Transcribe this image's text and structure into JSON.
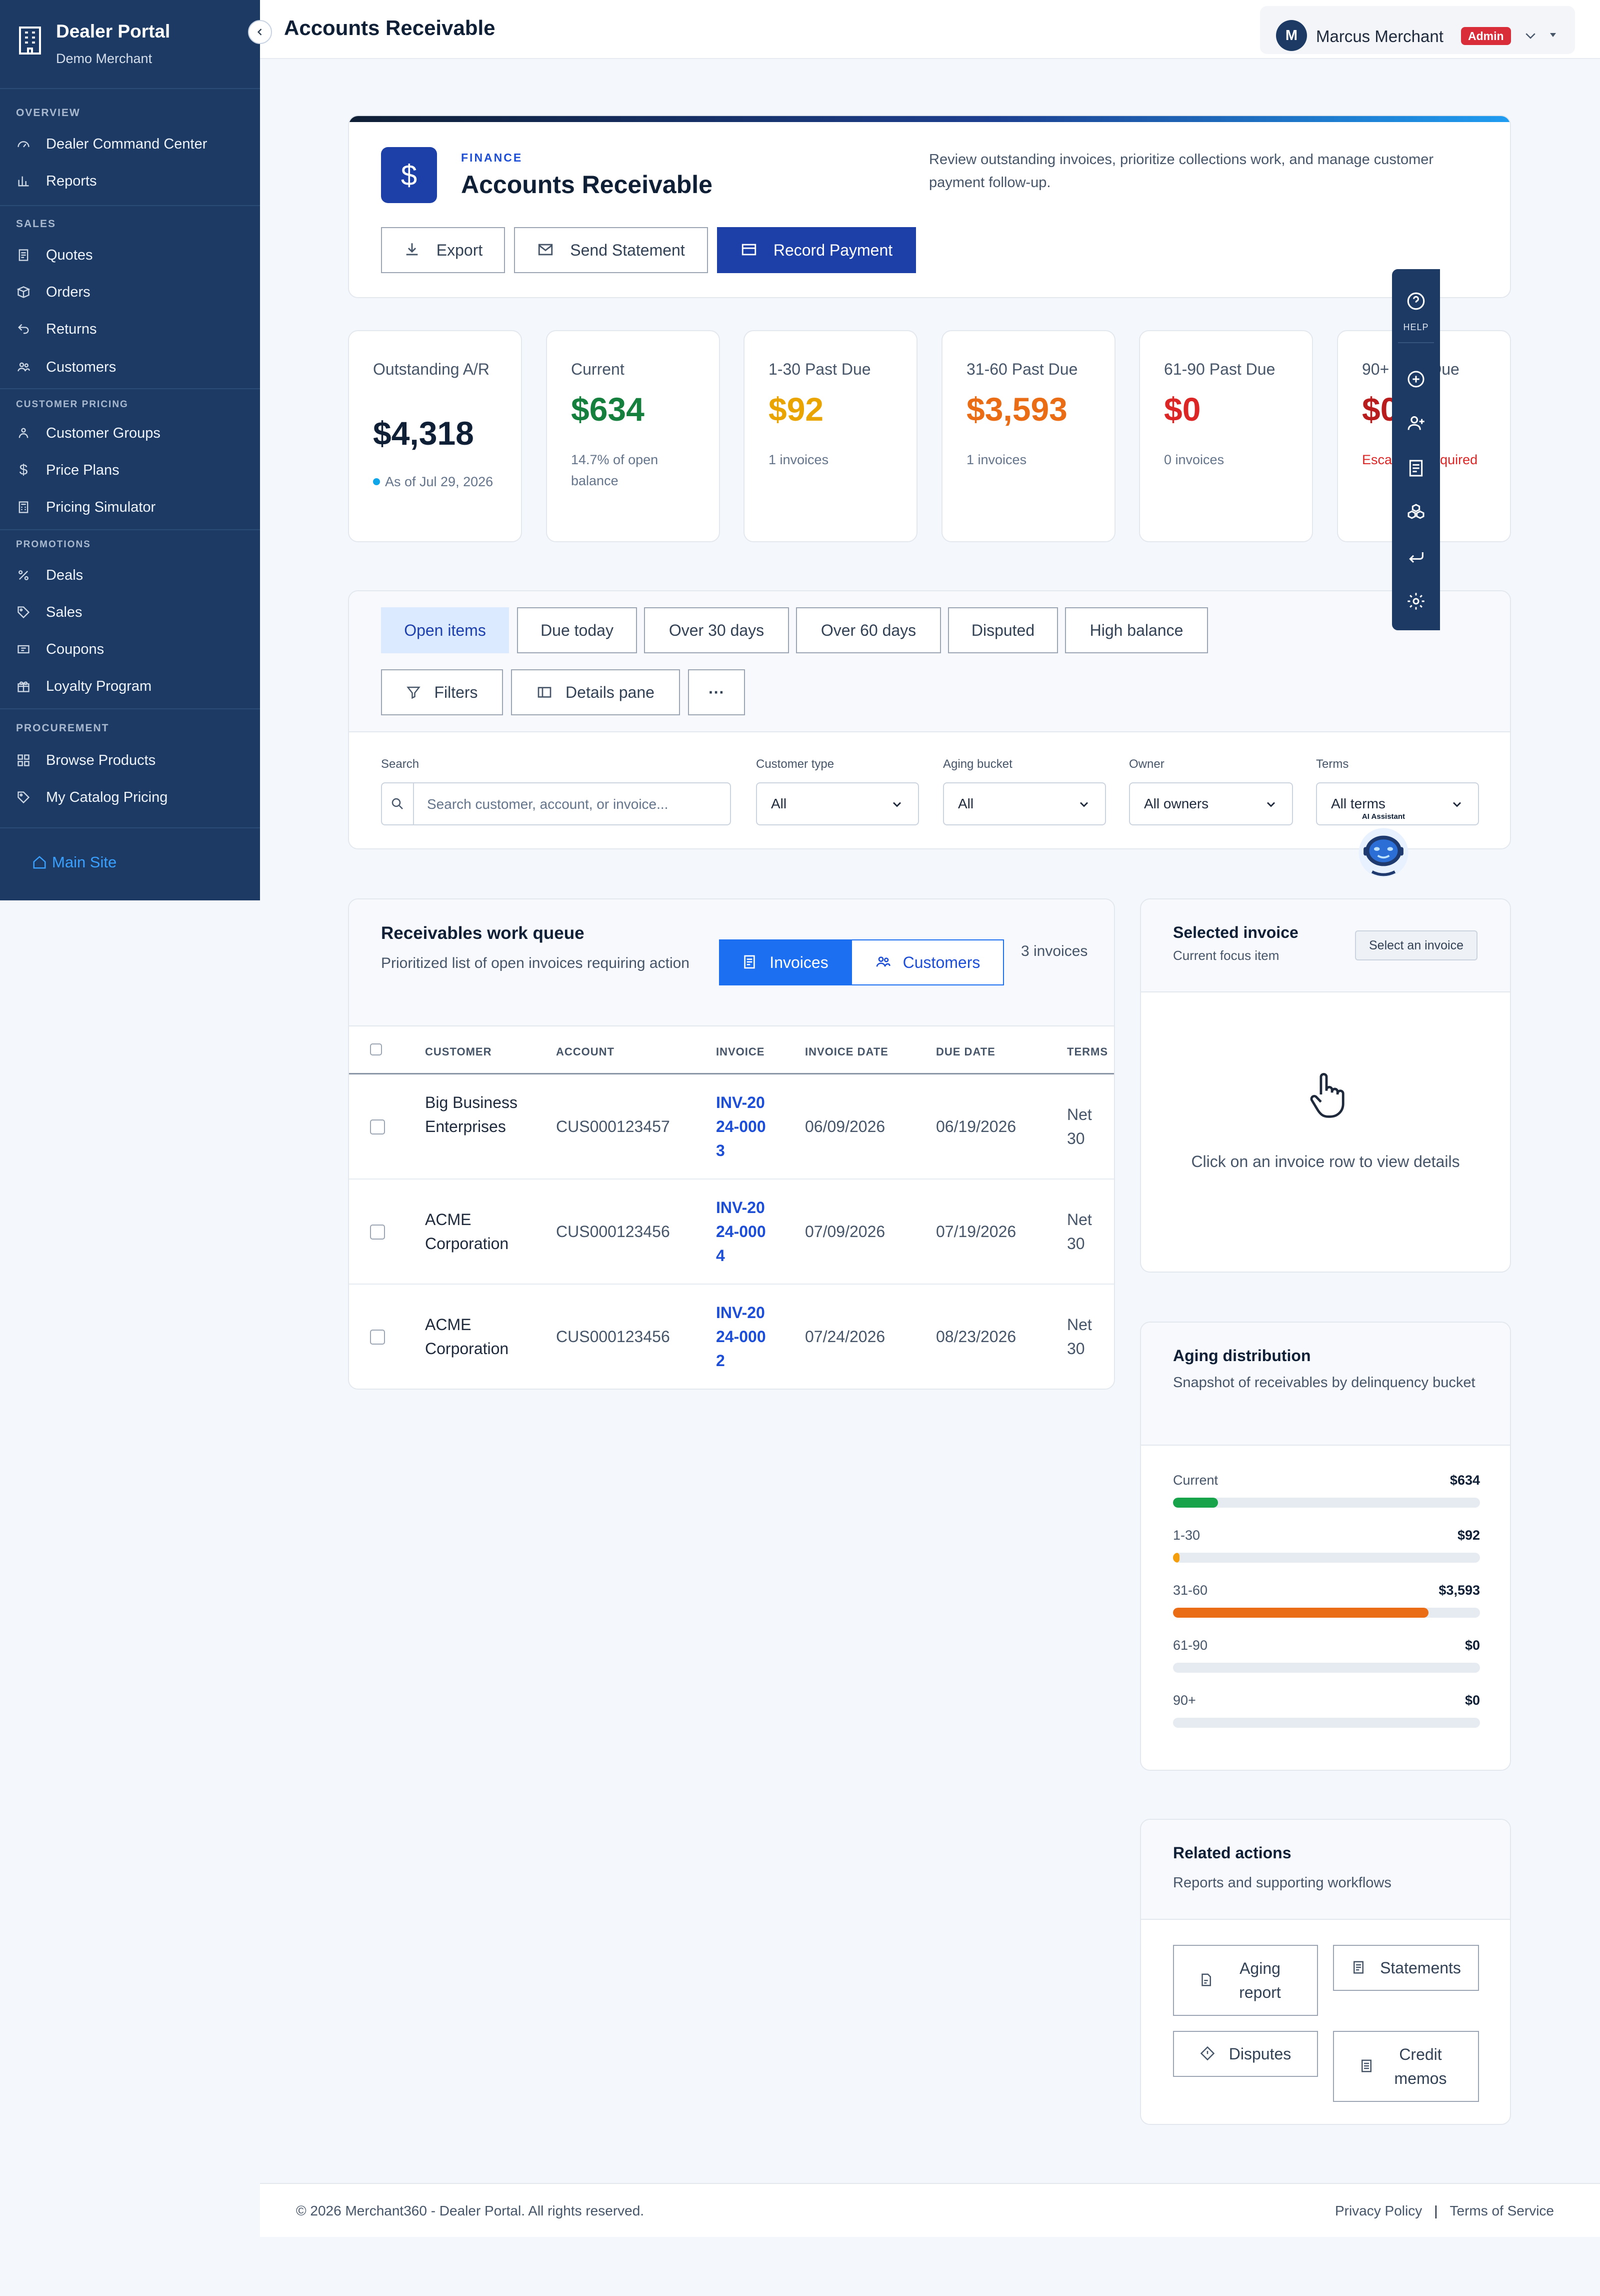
{
  "sidebar": {
    "brand_title": "Dealer Portal",
    "brand_subtitle": "Demo Merchant",
    "sections": [
      {
        "title": "OVERVIEW",
        "items": [
          {
            "label": "Dealer Command Center",
            "icon": "gauge-icon"
          },
          {
            "label": "Reports",
            "icon": "bar-chart-icon"
          }
        ]
      },
      {
        "title": "SALES",
        "items": [
          {
            "label": "Quotes",
            "icon": "document-icon"
          },
          {
            "label": "Orders",
            "icon": "box-icon"
          },
          {
            "label": "Returns",
            "icon": "return-arrow-icon"
          },
          {
            "label": "Customers",
            "icon": "users-icon"
          }
        ]
      },
      {
        "title": "CUSTOMER PRICING",
        "items": [
          {
            "label": "Customer Groups",
            "icon": "group-icon"
          },
          {
            "label": "Price Plans",
            "icon": "dollar-icon"
          },
          {
            "label": "Pricing Simulator",
            "icon": "calculator-icon"
          }
        ]
      },
      {
        "title": "PROMOTIONS",
        "items": [
          {
            "label": "Deals",
            "icon": "percent-icon"
          },
          {
            "label": "Sales",
            "icon": "tag-icon"
          },
          {
            "label": "Coupons",
            "icon": "ticket-icon"
          },
          {
            "label": "Loyalty Program",
            "icon": "gift-icon"
          }
        ]
      },
      {
        "title": "PROCUREMENT",
        "items": [
          {
            "label": "Browse Products",
            "icon": "grid-icon"
          },
          {
            "label": "My Catalog Pricing",
            "icon": "tag-icon"
          }
        ]
      }
    ],
    "main_site": "Main Site"
  },
  "header": {
    "title": "Accounts Receivable",
    "user_initial": "M",
    "user_name": "Marcus Merchant",
    "user_role": "Admin"
  },
  "hero": {
    "icon": "dollar-icon",
    "kicker": "FINANCE",
    "title": "Accounts Receivable",
    "description": "Review outstanding invoices, prioritize collections work, and manage customer payment follow-up.",
    "buttons": {
      "export": "Export",
      "send_statement": "Send Statement",
      "record_payment": "Record Payment"
    }
  },
  "kpis": [
    {
      "label": "Outstanding A/R",
      "value": "$4,318",
      "sub": "As of Jul 29, 2026",
      "color": "#0f1f35"
    },
    {
      "label": "Current",
      "value": "$634",
      "sub": "14.7% of open balance",
      "color": "#15803d"
    },
    {
      "label": "1-30 Past Due",
      "value": "$92",
      "sub": "1 invoices",
      "color": "#eaa400"
    },
    {
      "label": "31-60 Past Due",
      "value": "$3,593",
      "sub": "1 invoices",
      "color": "#ea6c14"
    },
    {
      "label": "61-90 Past Due",
      "value": "$0",
      "sub": "0 invoices",
      "color": "#dc2626"
    },
    {
      "label": "90+ Past Due",
      "value": "$0",
      "sub": "Escalation required",
      "color": "#b91c1c"
    }
  ],
  "filters": {
    "chips": [
      "Open items",
      "Due today",
      "Over 30 days",
      "Over 60 days",
      "Disputed",
      "High balance"
    ],
    "actions": {
      "filters": "Filters",
      "details_pane": "Details pane",
      "more": "···"
    },
    "search_label": "Search",
    "search_placeholder": "Search customer, account, or invoice...",
    "selects": [
      {
        "label": "Customer type",
        "value": "All"
      },
      {
        "label": "Aging bucket",
        "value": "All"
      },
      {
        "label": "Owner",
        "value": "All owners"
      },
      {
        "label": "Terms",
        "value": "All terms"
      }
    ]
  },
  "help_rail": {
    "help_label": "HELP",
    "ai_label": "AI Assistant"
  },
  "queue": {
    "title": "Receivables work queue",
    "subtitle": "Prioritized list of open invoices requiring action",
    "tab_invoices": "Invoices",
    "tab_customers": "Customers",
    "count": "3 invoices",
    "columns": [
      "CUSTOMER",
      "ACCOUNT",
      "INVOICE",
      "INVOICE DATE",
      "DUE DATE",
      "TERMS"
    ],
    "rows": [
      {
        "customer": "Big Business Enterprises",
        "account": "CUS000123457",
        "invoice": "INV-2024-0003",
        "invoice_date": "06/09/2026",
        "due_date": "06/19/2026",
        "terms": "Net 30"
      },
      {
        "customer": "ACME Corporation",
        "account": "CUS000123456",
        "invoice": "INV-2024-0004",
        "invoice_date": "07/09/2026",
        "due_date": "07/19/2026",
        "terms": "Net 30"
      },
      {
        "customer": "ACME Corporation",
        "account": "CUS000123456",
        "invoice": "INV-2024-0002",
        "invoice_date": "07/24/2026",
        "due_date": "08/23/2026",
        "terms": "Net 30"
      }
    ]
  },
  "selected": {
    "title": "Selected invoice",
    "subtitle": "Current focus item",
    "button": "Select an invoice",
    "empty": "Click on an invoice row to view details"
  },
  "aging": {
    "title": "Aging distribution",
    "subtitle": "Snapshot of receivables by delinquency bucket",
    "buckets": [
      {
        "label": "Current",
        "value": "$634",
        "fraction": 0.147,
        "color": "#16a34a"
      },
      {
        "label": "1-30",
        "value": "$92",
        "fraction": 0.021,
        "color": "#f59e0b"
      },
      {
        "label": "31-60",
        "value": "$3,593",
        "fraction": 0.832,
        "color": "#ea6c14"
      },
      {
        "label": "61-90",
        "value": "$0",
        "fraction": 0,
        "color": "#dc2626"
      },
      {
        "label": "90+",
        "value": "$0",
        "fraction": 0,
        "color": "#b91c1c"
      }
    ]
  },
  "related": {
    "title": "Related actions",
    "subtitle": "Reports and supporting workflows",
    "buttons": [
      "Aging report",
      "Statements",
      "Disputes",
      "Credit memos"
    ]
  },
  "footer": {
    "copyright": "© 2026 Merchant360 - Dealer Portal. All rights reserved.",
    "privacy": "Privacy Policy",
    "separator": "|",
    "terms": "Terms of Service"
  }
}
